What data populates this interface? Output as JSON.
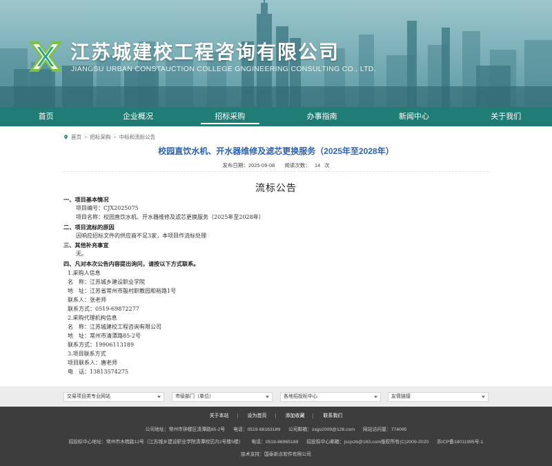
{
  "header": {
    "title_cn": "江苏城建校工程咨询有限公司",
    "title_en": "JIANGSU URBAN CONSTAUCTION COLLEGE GNGINEERING CONSULTING CO., LTD.",
    "logo_icon": "company-logo-icon"
  },
  "nav": {
    "items": [
      {
        "label": "首页"
      },
      {
        "label": "企业概况"
      },
      {
        "label": "招标采购"
      },
      {
        "label": "办事指南"
      },
      {
        "label": "新闻中心"
      },
      {
        "label": "关于我们"
      }
    ],
    "active_index": 2
  },
  "breadcrumb": {
    "home": "首页",
    "level1": "招标采购",
    "level2": "中标和流标公告",
    "separator": ">"
  },
  "article": {
    "title": "校园直饮水机、开水器维修及滤芯更换服务（2025年至2028年）",
    "publish_label": "发布日期：",
    "publish_date": "2025-09-08",
    "views_label": "阅读次数：",
    "views_count": "14",
    "views_unit": "次",
    "doc_title": "流标公告",
    "lines": [
      "一、项目基本情况",
      "项目编号：CJX2025075",
      "项目名称：校园直饮水机、开水器维修及滤芯更换服务（2025年至2028年）",
      "二、项目流标的原因",
      "因响应招标文件的供应商不足3家，本项目作流标处理",
      "三、其他补充事宜",
      "无。",
      "四、凡对本次公告内容提出询问，请按以下方式联系。",
      "1.采购人信息",
      "名　称：江苏城乡建设职业学院",
      "地　址：江苏省常州市殷村职教园和裕路1号",
      "联系人：张老师",
      "联系方式：0519-69872277",
      "2.采购代理机构信息",
      "名　称：江苏城建校工程咨询有限公司",
      "地　址：常州市清潭路85-2号",
      "联系方式：19906113189",
      "3.项目联系方式",
      "项目联系人：唐老师",
      "电　话：13813574275"
    ]
  },
  "links_strip": {
    "selects": [
      {
        "label": "交易项目类专业网站"
      },
      {
        "label": "市级部门（单位）"
      },
      {
        "label": "各地招投标中心"
      },
      {
        "label": "友情链接"
      }
    ]
  },
  "footer": {
    "links": [
      {
        "label": "关于本站"
      },
      {
        "label": "设为首页"
      },
      {
        "label": "添加收藏"
      },
      {
        "label": "联系我们"
      }
    ],
    "row1": {
      "address": "公司地址：常州市钟楼区清潭路85-2号",
      "phone": "电话：0519-88163189",
      "email": "公司邮箱：zxgs2009@126.com",
      "visits": "网站访问量：774095"
    },
    "row2": {
      "address": "招投标中心地址：常州市木梳路12号（江苏城乡建设职业学院清潭校区内2号楼5楼）",
      "phone": "电话：0519-86965189",
      "email": "招投标中心邮箱：jscjxzb@163.com版权所有(C)2009-2020",
      "icp": "苏ICP备18011995号-1"
    },
    "row3": "技术支持：国泰新点软件有限公司"
  },
  "colors": {
    "nav_bg": "#1f7d76",
    "title_blue": "#2b62b3",
    "footer_bg": "#3d3d3d"
  }
}
